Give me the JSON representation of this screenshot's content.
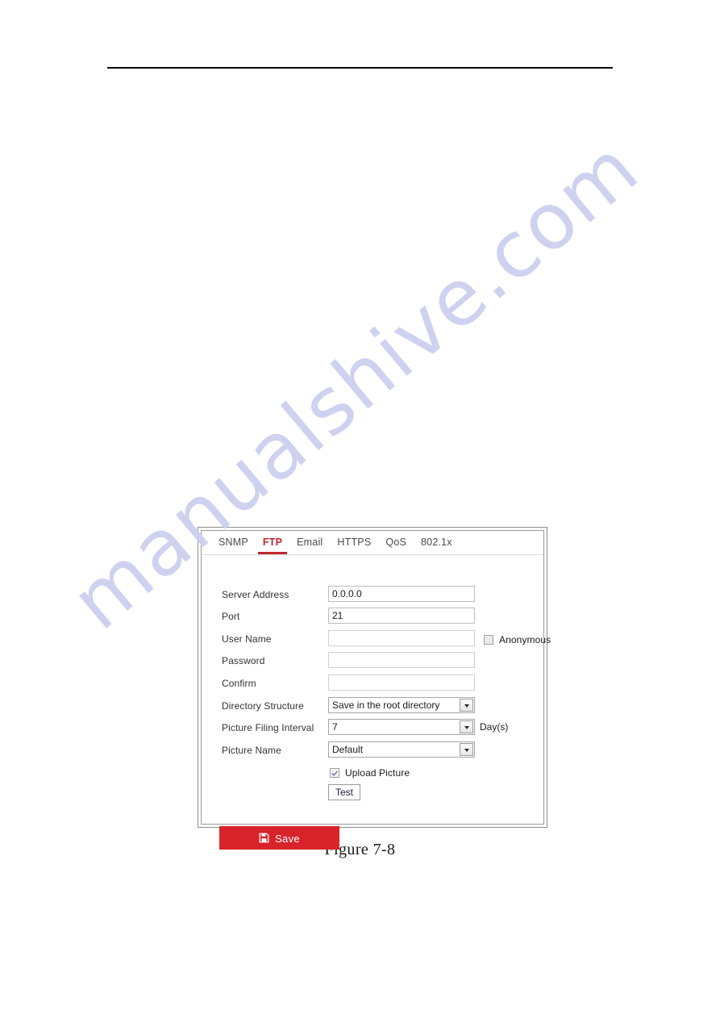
{
  "document": {
    "caption": "Figure 7-8",
    "watermark": "manualshive.com",
    "watermark_color": "#ccd0ef"
  },
  "panel": {
    "accent_color": "#c1272d",
    "tabs": [
      {
        "label": "SNMP",
        "active": false
      },
      {
        "label": "FTP",
        "active": true
      },
      {
        "label": "Email",
        "active": false
      },
      {
        "label": "HTTPS",
        "active": false
      },
      {
        "label": "QoS",
        "active": false
      },
      {
        "label": "802.1x",
        "active": false
      }
    ],
    "fields": {
      "server_address": {
        "label": "Server Address",
        "value": "0.0.0.0",
        "placeholder": ""
      },
      "port": {
        "label": "Port",
        "value": "21",
        "placeholder": ""
      },
      "user_name": {
        "label": "User Name",
        "value": "",
        "placeholder": ""
      },
      "password": {
        "label": "Password",
        "value": "",
        "placeholder": ""
      },
      "confirm": {
        "label": "Confirm",
        "value": "",
        "placeholder": ""
      },
      "directory_structure": {
        "label": "Directory Structure",
        "value": "Save in the root directory",
        "options": [
          "Save in the root directory"
        ]
      },
      "picture_filing_interval": {
        "label": "Picture Filing Interval",
        "value": "7",
        "suffix": "Day(s)",
        "options": [
          "7"
        ]
      },
      "picture_name": {
        "label": "Picture Name",
        "value": "Default",
        "options": [
          "Default"
        ]
      }
    },
    "checkboxes": {
      "anonymous": {
        "label": "Anonymous",
        "checked": false
      },
      "upload_picture": {
        "label": "Upload Picture",
        "checked": true
      }
    },
    "buttons": {
      "test": "Test",
      "save": "Save",
      "save_icon": "floppy-disk-icon"
    }
  }
}
